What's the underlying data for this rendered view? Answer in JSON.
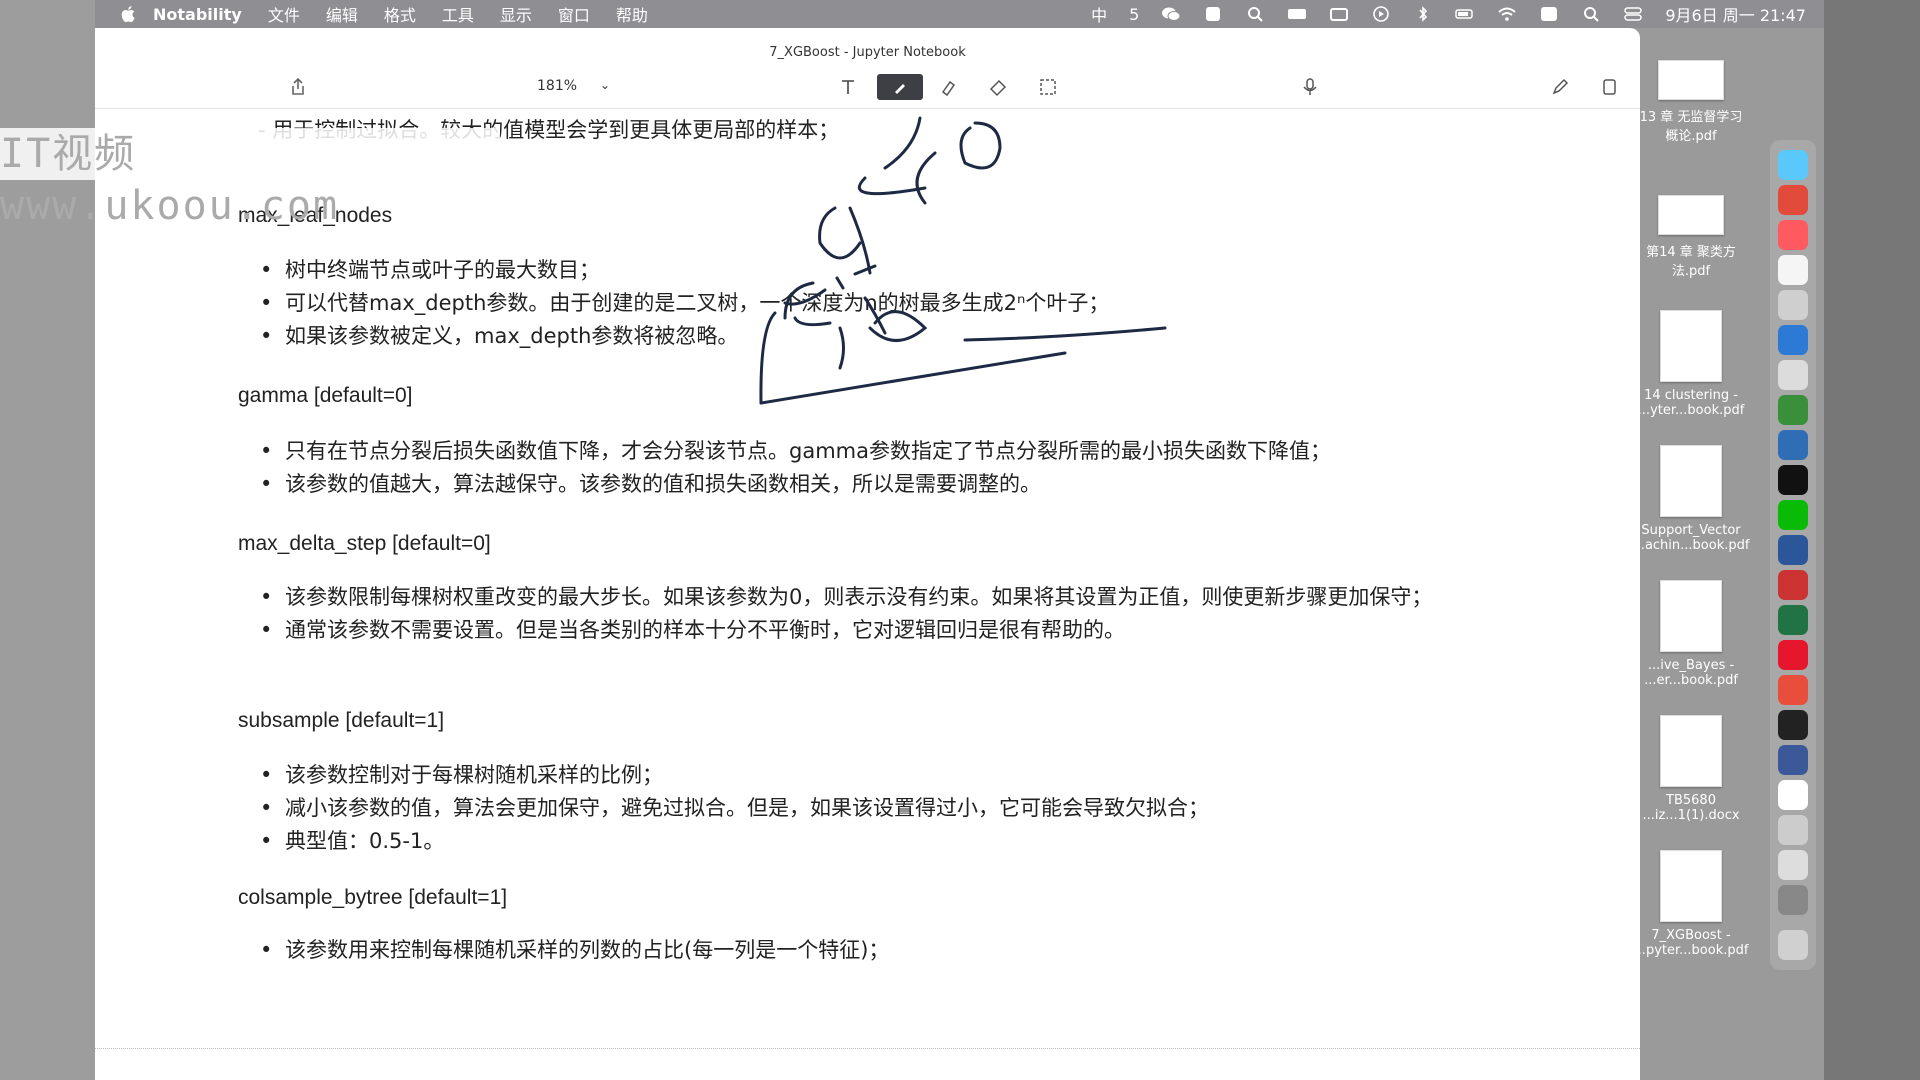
{
  "menubar": {
    "app_name": "Notability",
    "menus": [
      "文件",
      "编辑",
      "格式",
      "工具",
      "显示",
      "窗口",
      "帮助"
    ],
    "input_method": "中",
    "badge_number": "5",
    "datetime": "9月6日 周一 21:47"
  },
  "window": {
    "title": "7_XGBoost - Jupyter Notebook",
    "zoom": "181%"
  },
  "watermark": "IT视频 www.ukoou.com",
  "document": {
    "partial_line": "- 用于控制过拟合。较大的值模型会学到更具体更局部的样本；",
    "sections": [
      {
        "heading": "max_leaf_nodes",
        "bullets": [
          "树中终端节点或叶子的最大数目；",
          "可以代替max_depth参数。由于创建的是二叉树，一个深度为n的树最多生成2ⁿ个叶子；",
          "如果该参数被定义，max_depth参数将被忽略。"
        ]
      },
      {
        "heading": "gamma [default=0]",
        "bullets": [
          "只有在节点分裂后损失函数值下降，才会分裂该节点。gamma参数指定了节点分裂所需的最小损失函数下降值；",
          "该参数的值越大，算法越保守。该参数的值和损失函数相关，所以是需要调整的。"
        ]
      },
      {
        "heading": "max_delta_step [default=0]",
        "bullets": [
          "该参数限制每棵树权重改变的最大步长。如果该参数为0，则表示没有约束。如果将其设置为正值，则使更新步骤更加保守；",
          "通常该参数不需要设置。但是当各类别的样本十分不平衡时，它对逻辑回归是很有帮助的。"
        ]
      },
      {
        "heading": "subsample [default=1]",
        "bullets": [
          "该参数控制对于每棵树随机采样的比例；",
          "减小该参数的值，算法会更加保守，避免过拟合。但是，如果该设置得过小，它可能会导致欠拟合；",
          "典型值：0.5-1。"
        ]
      },
      {
        "heading": "colsample_bytree [default=1]",
        "bullets": [
          "该参数用来控制每棵随机采样的列数的占比(每一列是一个特征)；"
        ]
      }
    ]
  },
  "desktop_files": [
    {
      "name": "13 章 无监督学习\n概论.pdf"
    },
    {
      "name": "第14 章 聚类方\n法.pdf"
    },
    {
      "name": "14 clustering -\n...yter...book.pdf"
    },
    {
      "name": "Support_Vector\n...achin...book.pdf"
    },
    {
      "name": "...ive_Bayes -\n...er...book.pdf"
    },
    {
      "name": "TB5680\n...iz...1(1).docx"
    },
    {
      "name": "7_XGBoost -\n...pyter...book.pdf"
    }
  ],
  "colors": {
    "menubar": "#8e8e93",
    "window": "#ffffff",
    "ink": "#1e2a44"
  }
}
